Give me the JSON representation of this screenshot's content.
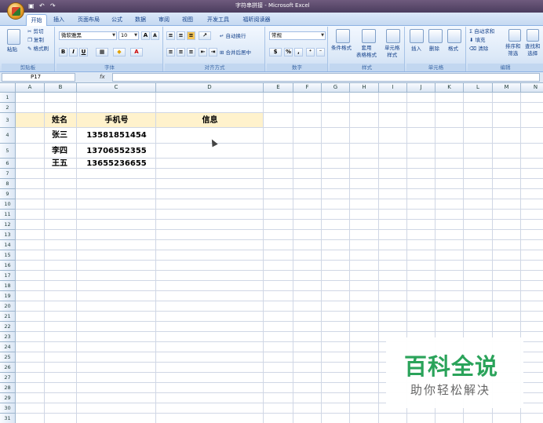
{
  "window": {
    "title": "字符串拼接 - Microsoft Excel"
  },
  "quick_access": {
    "save": "▣",
    "undo": "↶",
    "redo": "↷"
  },
  "tabs": [
    "开始",
    "插入",
    "页面布局",
    "公式",
    "数据",
    "审阅",
    "视图",
    "开发工具",
    "福昕阅读器"
  ],
  "active_tab": "开始",
  "ribbon": {
    "clipboard": {
      "paste": "粘贴",
      "cut": "剪切",
      "copy": "复制",
      "format_painter": "格式刷",
      "label": "剪贴板"
    },
    "font": {
      "family": "微软雅黑",
      "size": "10",
      "grow": "A",
      "shrink": "A",
      "bold": "B",
      "italic": "I",
      "underline": "U",
      "color_letter": "A",
      "label": "字体"
    },
    "alignment": {
      "wrap": "自动换行",
      "merge": "合并后居中",
      "label": "对齐方式"
    },
    "number": {
      "format": "常规",
      "percent": "%",
      "comma": ",",
      "label": "数字"
    },
    "styles": {
      "conditional": "条件格式",
      "table": "套用\n表格格式",
      "cell": "单元格\n样式",
      "label": "样式"
    },
    "cells": {
      "insert": "插入",
      "delete": "删除",
      "format": "格式",
      "label": "单元格"
    },
    "editing": {
      "autosum": "自动求和",
      "fill": "填充",
      "clear": "清除",
      "sort": "排序和\n筛选",
      "find": "查找和\n选择",
      "label": "编辑"
    }
  },
  "formula_bar": {
    "name_box": "P17",
    "fx": "fx",
    "formula": ""
  },
  "columns": [
    "A",
    "B",
    "C",
    "D",
    "E",
    "F",
    "G",
    "H",
    "I",
    "J",
    "K",
    "L",
    "M",
    "N"
  ],
  "rows": [
    "1",
    "2",
    "3",
    "4",
    "5",
    "6",
    "7",
    "8",
    "9",
    "10",
    "11",
    "12",
    "13",
    "14",
    "15",
    "16",
    "17",
    "18",
    "19",
    "20",
    "21",
    "22",
    "23",
    "24",
    "25",
    "26",
    "27",
    "28",
    "29",
    "30",
    "31"
  ],
  "sheet": {
    "headers": {
      "name": "姓名",
      "phone": "手机号",
      "info": "信息"
    },
    "records": [
      {
        "name": "张三",
        "phone": "13581851454"
      },
      {
        "name": "李四",
        "phone": "13706552355"
      },
      {
        "name": "王五",
        "phone": "13655236655"
      }
    ],
    "header_fill": "#fff2cc"
  },
  "watermark": {
    "title": "百科全说",
    "subtitle": "助你轻松解决",
    "color": "#2aa35a"
  }
}
